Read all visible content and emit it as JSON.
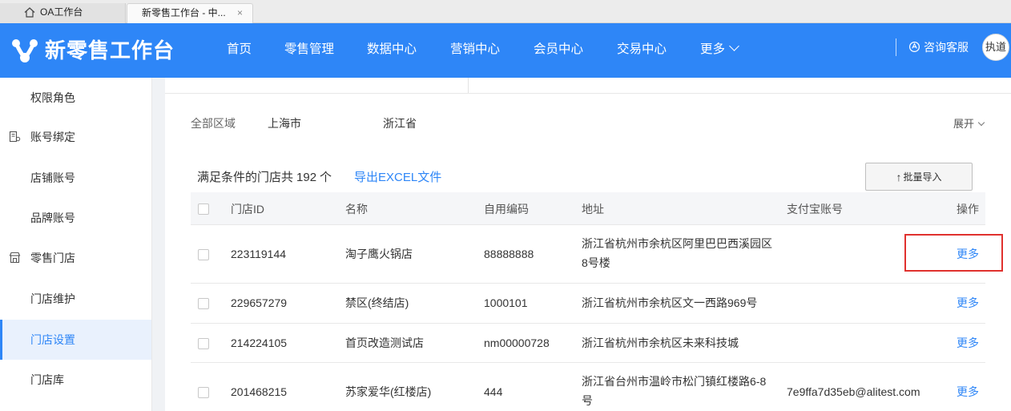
{
  "tabs": [
    {
      "label": "OA工作台",
      "icon": "home-icon",
      "active": false
    },
    {
      "label": "新零售工作台 - 中...",
      "active": true,
      "close": "×"
    }
  ],
  "header": {
    "logo_text": "新零售工作台",
    "nav": [
      "首页",
      "零售管理",
      "数据中心",
      "营销中心",
      "会员中心",
      "交易中心",
      "更多"
    ],
    "service_label": "咨询客服",
    "avatar_text": "执道",
    "bg_color": "#2e86f7"
  },
  "sidebar": {
    "items": [
      {
        "label": "权限角色",
        "type": "child"
      },
      {
        "label": "账号绑定",
        "type": "group",
        "icon": "account-bind-icon"
      },
      {
        "label": "店铺账号",
        "type": "child"
      },
      {
        "label": "品牌账号",
        "type": "child"
      },
      {
        "label": "零售门店",
        "type": "group",
        "icon": "store-icon"
      },
      {
        "label": "门店维护",
        "type": "child"
      },
      {
        "label": "门店设置",
        "type": "child",
        "active": true
      },
      {
        "label": "门店库",
        "type": "child"
      }
    ]
  },
  "filter": {
    "region_label": "全部区域",
    "regions": [
      "上海市",
      "浙江省"
    ],
    "expand_label": "展开"
  },
  "summary": {
    "prefix": "满足条件的门店共",
    "count": "192",
    "suffix": "个",
    "export_label": "导出EXCEL文件",
    "import_label": "批量导入"
  },
  "table": {
    "columns": [
      "门店ID",
      "名称",
      "自用编码",
      "地址",
      "支付宝账号",
      "操作"
    ],
    "rows": [
      {
        "id": "223119144",
        "name": "淘子鹰火锅店",
        "code": "88888888",
        "address_l1": "浙江省杭州市余杭区阿里巴巴西溪园区",
        "address_l2": "8号楼",
        "alipay": "",
        "action": "更多"
      },
      {
        "id": "229657279",
        "name": "禁区(终结店)",
        "code": "1000101",
        "address_l1": "浙江省杭州市余杭区文一西路969号",
        "address_l2": "",
        "alipay": "",
        "action": "更多"
      },
      {
        "id": "214224105",
        "name": "首页改造测试店",
        "code": "nm00000728",
        "address_l1": "浙江省杭州市余杭区未来科技城",
        "address_l2": "",
        "alipay": "",
        "action": "更多"
      },
      {
        "id": "201468215",
        "name": "苏家爱华(红楼店)",
        "code": "444",
        "address_l1": "浙江省台州市温岭市松门镇红楼路6-8",
        "address_l2": "号",
        "alipay": "7e9ffa7d35eb@alitest.com",
        "action": "更多"
      }
    ]
  },
  "highlight_color": "#e0312e",
  "link_color": "#2e86f7"
}
